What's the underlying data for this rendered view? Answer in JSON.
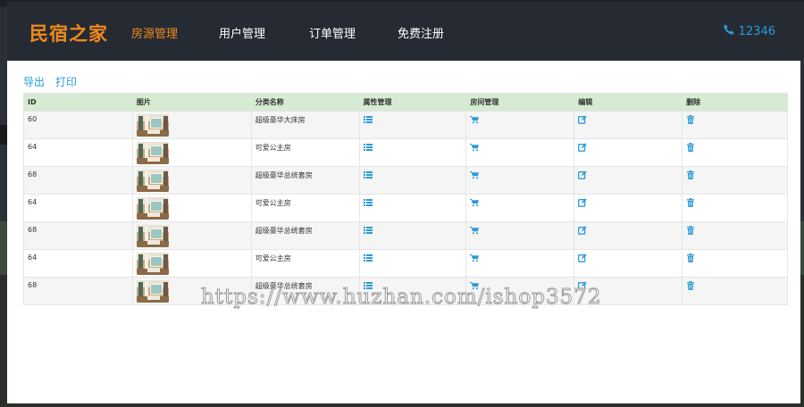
{
  "brand": "民宿之家",
  "nav": {
    "items": [
      {
        "label": "房源管理",
        "active": true
      },
      {
        "label": "用户管理",
        "active": false
      },
      {
        "label": "订单管理",
        "active": false
      },
      {
        "label": "免费注册",
        "active": false
      }
    ],
    "phone": "12346"
  },
  "toolbar": {
    "export_label": "导出",
    "print_label": "打印"
  },
  "table": {
    "headers": [
      "ID",
      "图片",
      "分类名称",
      "属性管理",
      "房间管理",
      "编辑",
      "删除"
    ],
    "rows": [
      {
        "id": "60",
        "category": "超级豪华大床房"
      },
      {
        "id": "64",
        "category": "可爱公主房"
      },
      {
        "id": "68",
        "category": "超级豪华总统套房"
      },
      {
        "id": "64",
        "category": "可爱公主房"
      },
      {
        "id": "68",
        "category": "超级豪华总统套房"
      },
      {
        "id": "64",
        "category": "可爱公主房"
      },
      {
        "id": "68",
        "category": "超级豪华总统套房"
      }
    ]
  },
  "icons": {
    "attribute": "list-icon",
    "room": "cart-icon",
    "edit": "edit-icon",
    "delete": "trash-icon",
    "phone": "phone-icon"
  },
  "colors": {
    "brand": "#f08a1b",
    "accent": "#2a9bd6",
    "header_bg": "#d6ecd2",
    "navbar_bg": "#262b33"
  },
  "watermark": "https://www.huzhan.com/ishop3572"
}
